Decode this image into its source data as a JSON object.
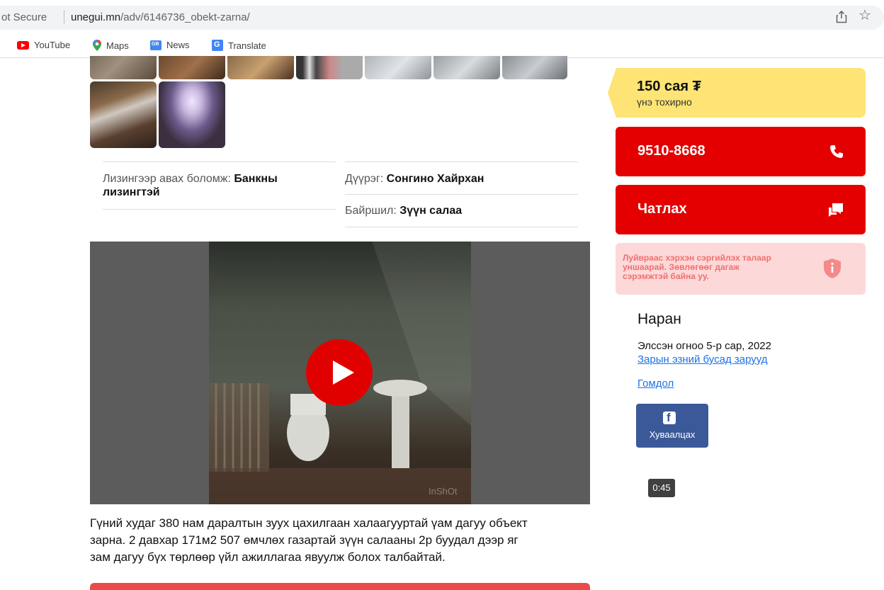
{
  "browser": {
    "security_label": "ot Secure",
    "url_domain": "unegui.mn",
    "url_path": "/adv/6146736_obekt-zarna/",
    "bookmarks": [
      {
        "label": "YouTube",
        "icon": "youtube-icon"
      },
      {
        "label": "Maps",
        "icon": "maps-icon"
      },
      {
        "label": "News",
        "icon": "news-icon"
      },
      {
        "label": "Translate",
        "icon": "translate-icon"
      }
    ]
  },
  "attributes": {
    "leasing_label": "Лизингээр авах боломж:",
    "leasing_value_line1": "Банкны",
    "leasing_value_line2": "лизингтэй",
    "district_label": "Дүүрэг:",
    "district_value": "Сонгино Хайрхан",
    "location_label": "Байршил:",
    "location_value": "Зүүн салаа"
  },
  "video": {
    "duration": "0:45",
    "watermark": "InShOt"
  },
  "description": {
    "line1": "Гүний худаг 380 нам даралтын зуух цахилгаан халаагууртай үам дагуу объект",
    "line2": "зарна. 2 давхар 171м2 507 өмчлөх газартай зүүн салааны 2р буудал дээр яг",
    "line3": "зам дагуу бүх төрлөөр үйл ажиллагаа явуулж болох талбайтай."
  },
  "sidebar": {
    "price": "150 сая ₮",
    "price_note": "үнэ тохирно",
    "phone": "9510-8668",
    "chat": "Чатлах",
    "warning_line1": "Луйвраас хэрхэн сэргийлэх талаар",
    "warning_line2": "уншаарай. Зөвлөгөөг дагаж",
    "warning_line3": "сэрэмжтэй байна уу.",
    "seller_name": "Наран",
    "seller_joined": "Элссэн огноо 5-р сар, 2022",
    "seller_other_ads": "Зарын эзний бусад зарууд",
    "complaint": "Гомдол",
    "share": "Хуваалцах"
  },
  "colors": {
    "accent_red": "#e40000",
    "price_yellow": "#fde474",
    "warning_bg": "#fdd8d8",
    "facebook_blue": "#3b5998",
    "link_blue": "#1a73e8"
  }
}
